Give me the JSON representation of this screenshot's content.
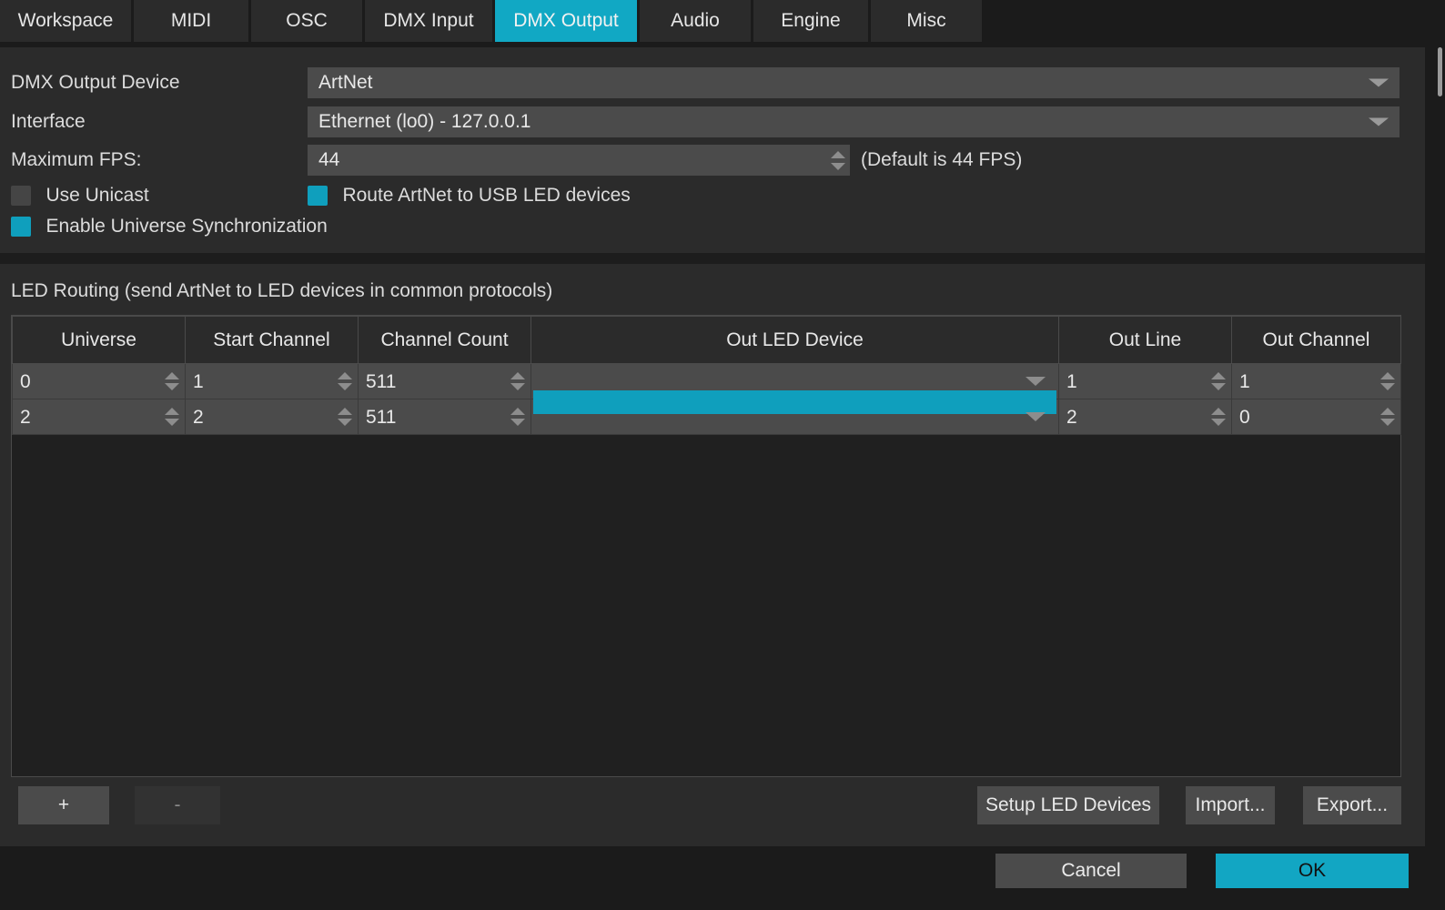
{
  "tabs": [
    {
      "label": "Workspace",
      "active": false
    },
    {
      "label": "MIDI",
      "active": false
    },
    {
      "label": "OSC",
      "active": false
    },
    {
      "label": "DMX Input",
      "active": false
    },
    {
      "label": "DMX Output",
      "active": true
    },
    {
      "label": "Audio",
      "active": false
    },
    {
      "label": "Engine",
      "active": false
    },
    {
      "label": "Misc",
      "active": false
    }
  ],
  "form": {
    "device_label": "DMX Output Device",
    "device_value": "ArtNet",
    "interface_label": "Interface",
    "interface_value": "Ethernet (lo0) - 127.0.0.1",
    "fps_label": "Maximum FPS:",
    "fps_value": "44",
    "fps_hint": "(Default is 44 FPS)",
    "checkboxes": [
      {
        "label": "Use Unicast",
        "checked": false
      },
      {
        "label": "Route ArtNet to USB LED devices",
        "checked": true
      },
      {
        "label": "Enable Universe Synchronization",
        "checked": true
      }
    ]
  },
  "routing": {
    "section_title": "LED Routing (send ArtNet to LED devices in common protocols)",
    "columns": [
      "Universe",
      "Start Channel",
      "Channel Count",
      "Out LED Device",
      "Out Line",
      "Out Channel"
    ],
    "rows": [
      {
        "universe": "0",
        "start_channel": "1",
        "channel_count": "511",
        "out_led_device": "",
        "out_line": "1",
        "out_channel": "1",
        "device_selected": false
      },
      {
        "universe": "2",
        "start_channel": "2",
        "channel_count": "511",
        "out_led_device": "",
        "out_line": "2",
        "out_channel": "0",
        "device_selected": true
      }
    ],
    "buttons": {
      "add": "+",
      "remove": "-",
      "setup": "Setup LED Devices",
      "import": "Import...",
      "export": "Export..."
    }
  },
  "footer": {
    "cancel": "Cancel",
    "ok": "OK"
  },
  "colors": {
    "accent": "#11a8c4",
    "panel": "#2b2b2b",
    "field": "#4b4b4b",
    "window": "#1b1b1b"
  }
}
